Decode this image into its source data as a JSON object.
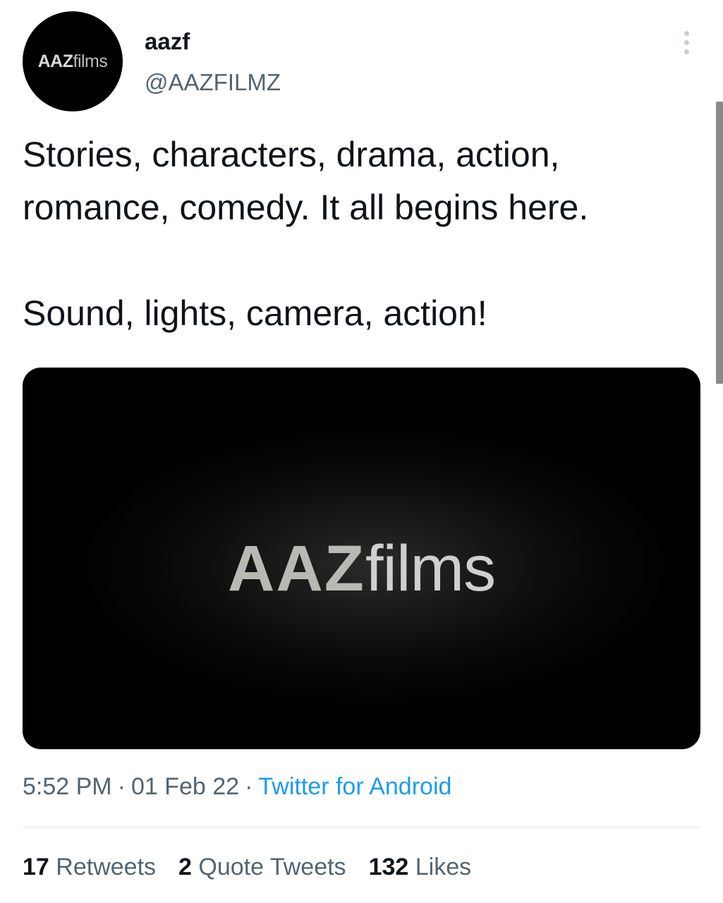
{
  "author": {
    "display_name": "aazf",
    "handle": "@AAZFILMZ",
    "avatar_logo": {
      "bold": "AAZ",
      "thin": "films"
    }
  },
  "tweet": {
    "paragraphs": [
      "Stories, characters, drama, action, romance, comedy. It all begins here.",
      "Sound, lights, camera, action!"
    ],
    "media": {
      "logo_bold": "AAZ",
      "logo_thin": "films"
    }
  },
  "meta": {
    "time": "5:52 PM",
    "separator": "·",
    "date": "01 Feb 22",
    "source": "Twitter for Android"
  },
  "stats": {
    "retweets": {
      "count": "17",
      "label": "Retweets"
    },
    "quote_tweets": {
      "count": "2",
      "label": "Quote Tweets"
    },
    "likes": {
      "count": "132",
      "label": "Likes"
    }
  },
  "icons": {
    "more": "more-vertical-icon"
  },
  "colors": {
    "link": "#1d9bf0",
    "secondary_text": "#536471",
    "primary_text": "#0f1419"
  }
}
